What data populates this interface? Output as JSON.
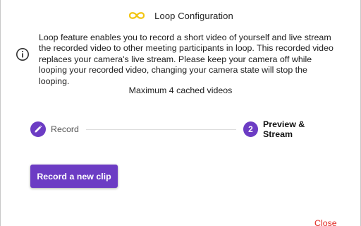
{
  "dialog": {
    "title": "Loop Configuration",
    "title_icon": "infinity-loop-icon",
    "accent_color": "#f2c511"
  },
  "info": {
    "icon": "info-icon",
    "description": "Loop feature enables you to record a short video of yourself and live stream the recorded video to other meeting participants in loop. This recorded video replaces your camera's live stream. Please keep your camera off while looping your recorded video, changing your camera state will stop the looping.",
    "max_cached": "Maximum 4 cached videos"
  },
  "stepper": {
    "steps": [
      {
        "label": "Record",
        "icon": "pencil-icon",
        "state": "completed"
      },
      {
        "label": "Preview & Stream",
        "number": "2",
        "state": "active"
      }
    ],
    "primary_color": "#6c3cc4"
  },
  "actions": {
    "record_label": "Record a new clip",
    "close_label": "Close",
    "close_color": "#e0261f"
  }
}
